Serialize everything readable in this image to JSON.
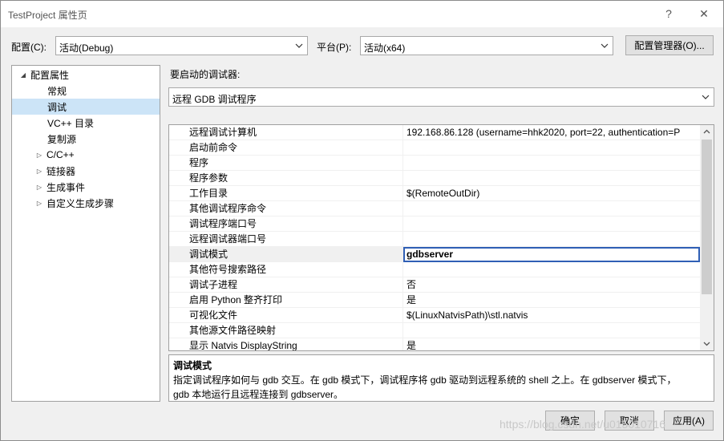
{
  "window": {
    "title": "TestProject 属性页",
    "help_glyph": "?",
    "close_glyph": "✕"
  },
  "config_bar": {
    "config_label": "配置(C):",
    "config_value": "活动(Debug)",
    "platform_label": "平台(P):",
    "platform_value": "活动(x64)",
    "manager_button": "配置管理器(O)..."
  },
  "tree": {
    "items": [
      {
        "label": "配置属性",
        "expander": "◢"
      },
      {
        "label": "常规",
        "expander": ""
      },
      {
        "label": "调试",
        "expander": ""
      },
      {
        "label": "VC++ 目录",
        "expander": ""
      },
      {
        "label": "复制源",
        "expander": ""
      },
      {
        "label": "C/C++",
        "expander": "▷"
      },
      {
        "label": "链接器",
        "expander": "▷"
      },
      {
        "label": "生成事件",
        "expander": "▷"
      },
      {
        "label": "自定义生成步骤",
        "expander": "▷"
      }
    ],
    "selected_index": 2
  },
  "debugger": {
    "label": "要启动的调试器:",
    "value": "远程 GDB 调试程序"
  },
  "properties": [
    {
      "name": "远程调试计算机",
      "value": "192.168.86.128 (username=hhk2020, port=22, authentication=P"
    },
    {
      "name": "启动前命令",
      "value": ""
    },
    {
      "name": "程序",
      "value": ""
    },
    {
      "name": "程序参数",
      "value": ""
    },
    {
      "name": "工作目录",
      "value": "$(RemoteOutDir)"
    },
    {
      "name": "其他调试程序命令",
      "value": ""
    },
    {
      "name": "调试程序端口号",
      "value": ""
    },
    {
      "name": "远程调试器端口号",
      "value": ""
    },
    {
      "name": "调试模式",
      "value": "gdbserver"
    },
    {
      "name": "其他符号搜索路径",
      "value": ""
    },
    {
      "name": "调试子进程",
      "value": "否"
    },
    {
      "name": "启用 Python 整齐打印",
      "value": "是"
    },
    {
      "name": "可视化文件",
      "value": "$(LinuxNatvisPath)\\stl.natvis"
    },
    {
      "name": "其他源文件路径映射",
      "value": ""
    },
    {
      "name": "显示 Natvis DisplayString",
      "value": "是"
    }
  ],
  "selected_property_index": 8,
  "description": {
    "title": "调试模式",
    "line1": "指定调试程序如何与 gdb 交互。在 gdb 模式下，调试程序将 gdb 驱动到远程系统的 shell 之上。在 gdbserver 模式下，",
    "line2": "gdb 本地运行且远程连接到 gdbserver。"
  },
  "footer": {
    "ok_button": "确定",
    "cancel_button": "取消",
    "apply_button": "应用(A)"
  },
  "watermark": "https://blog.csdn.net/u015010716",
  "colors": {
    "selection_border": "#2f5fb5",
    "tree_selection": "#cce4f7"
  }
}
